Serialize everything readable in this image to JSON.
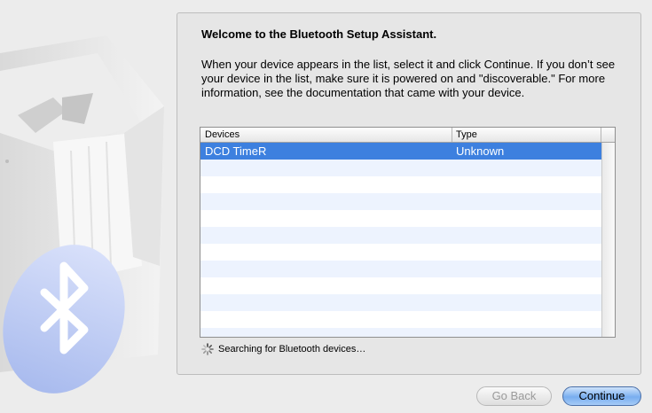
{
  "panel": {
    "title": "Welcome to the Bluetooth Setup Assistant.",
    "intro": "When your device appears in the list, select it and click Continue. If you don’t see your device in the list, make sure it is powered on and \"discoverable.\" For more information, see the documentation that came with your device."
  },
  "devices_table": {
    "columns": [
      "Devices",
      "Type"
    ],
    "rows": [
      {
        "device": "DCD TimeR",
        "type": "Unknown",
        "selected": true
      }
    ]
  },
  "status": {
    "searching_text": "Searching for Bluetooth devices…"
  },
  "buttons": {
    "back_label": "Go Back",
    "continue_label": "Continue"
  },
  "colors": {
    "selection": "#3d80df",
    "bluetooth_badge": "#b8c7f2"
  }
}
